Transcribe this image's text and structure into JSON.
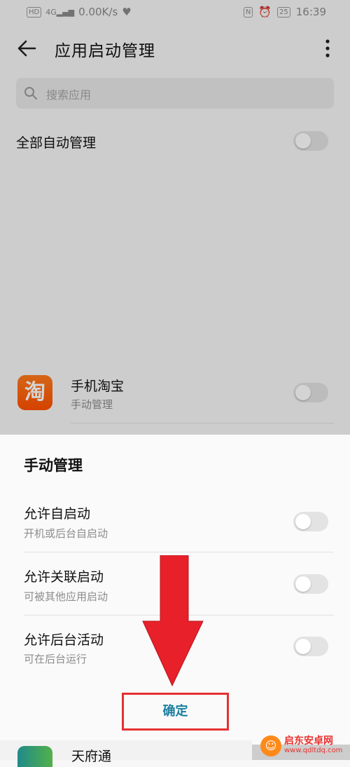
{
  "status_bar": {
    "left_chip": "HD",
    "signal_label": "4G",
    "speed": "0.00K/s",
    "nfc": "N",
    "battery": "25",
    "time": "16:39"
  },
  "header": {
    "title": "应用启动管理"
  },
  "search": {
    "placeholder": "搜索应用"
  },
  "all_auto": {
    "label": "全部自动管理",
    "enabled": false
  },
  "apps": [
    {
      "name": "手机淘宝",
      "status": "手动管理",
      "icon_glyph": "淘",
      "enabled": false
    },
    {
      "name": "天府通"
    }
  ],
  "sheet": {
    "title": "手动管理",
    "options": [
      {
        "label": "允许自启动",
        "desc": "开机或后台自启动",
        "enabled": false
      },
      {
        "label": "允许关联启动",
        "desc": "可被其他应用启动",
        "enabled": false
      },
      {
        "label": "允许后台活动",
        "desc": "可在后台运行",
        "enabled": false
      }
    ],
    "confirm_label": "确定"
  },
  "colors": {
    "accent": "#1a7fa0",
    "annotation_red": "#e53030",
    "taobao_orange": "#ff5000"
  },
  "watermark": {
    "name": "启东安卓网",
    "url": "www.qdltdq.com"
  }
}
